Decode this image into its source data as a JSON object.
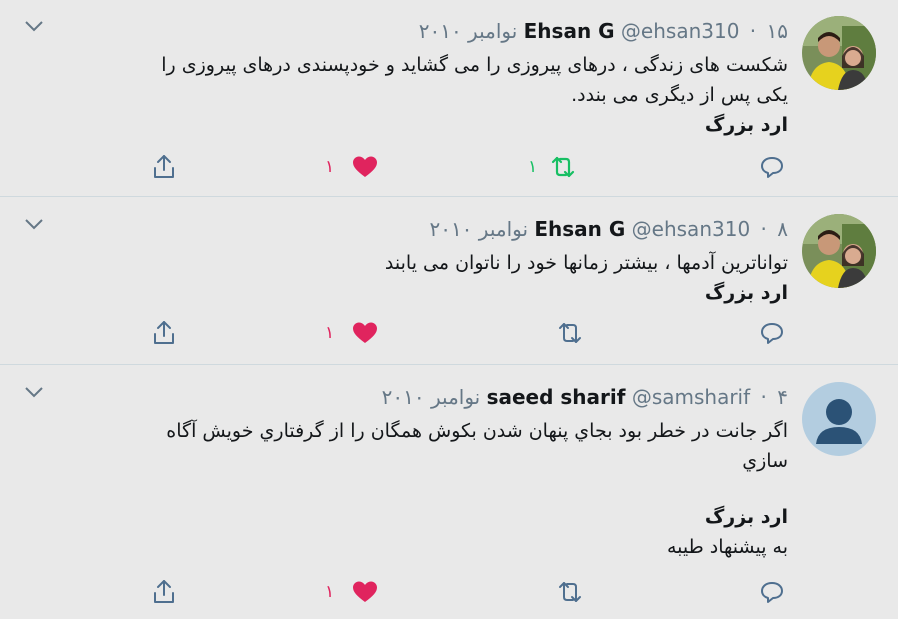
{
  "colors": {
    "like": "#e0245e",
    "retweet_active": "#17bf63",
    "icon": "#657786",
    "avatar_default_bg": "#b3cde0"
  },
  "tweets": [
    {
      "name": "Ehsan G",
      "handle": "@ehsan310",
      "date": "۱۵ نوامبر ۲۰۱۰",
      "text_lines": [
        "شکست های زندگی ، درهای پیروزی را  می گشاید و خودپسندی درهای پیروزی را",
        "یکی پس از دیگری می بندد."
      ],
      "signature": "ارد بزرگ",
      "extra": "",
      "likes": "۱",
      "retweets": "۱",
      "avatar": "photo",
      "icons": {
        "reply": "reply-icon",
        "retweet": "retweet-icon",
        "like": "heart-icon",
        "share": "share-icon"
      }
    },
    {
      "name": "Ehsan G",
      "handle": "@ehsan310",
      "date": "۸ نوامبر ۲۰۱۰",
      "text_lines": [
        "تواناترین آدمها ، بیشتر زمانها خود را ناتوان می یابند"
      ],
      "signature": "ارد بزرگ",
      "extra": "",
      "likes": "۱",
      "retweets": "",
      "avatar": "photo",
      "icons": {
        "reply": "reply-icon",
        "retweet": "retweet-icon",
        "like": "heart-icon",
        "share": "share-icon"
      }
    },
    {
      "name": "saeed sharif",
      "handle": "@samsharif",
      "date": "۴ نوامبر ۲۰۱۰",
      "text_lines": [
        "اگر جانت در خطر بود بجاي پنهان شدن بکوش همگان را از گرفتاري خويش آگاه",
        "سازي"
      ],
      "signature": "ارد بزرگ",
      "extra": "به پیشنهاد طیبه",
      "likes": "۱",
      "retweets": "",
      "avatar": "default",
      "icons": {
        "reply": "reply-icon",
        "retweet": "retweet-icon",
        "like": "heart-icon",
        "share": "share-icon"
      }
    }
  ]
}
